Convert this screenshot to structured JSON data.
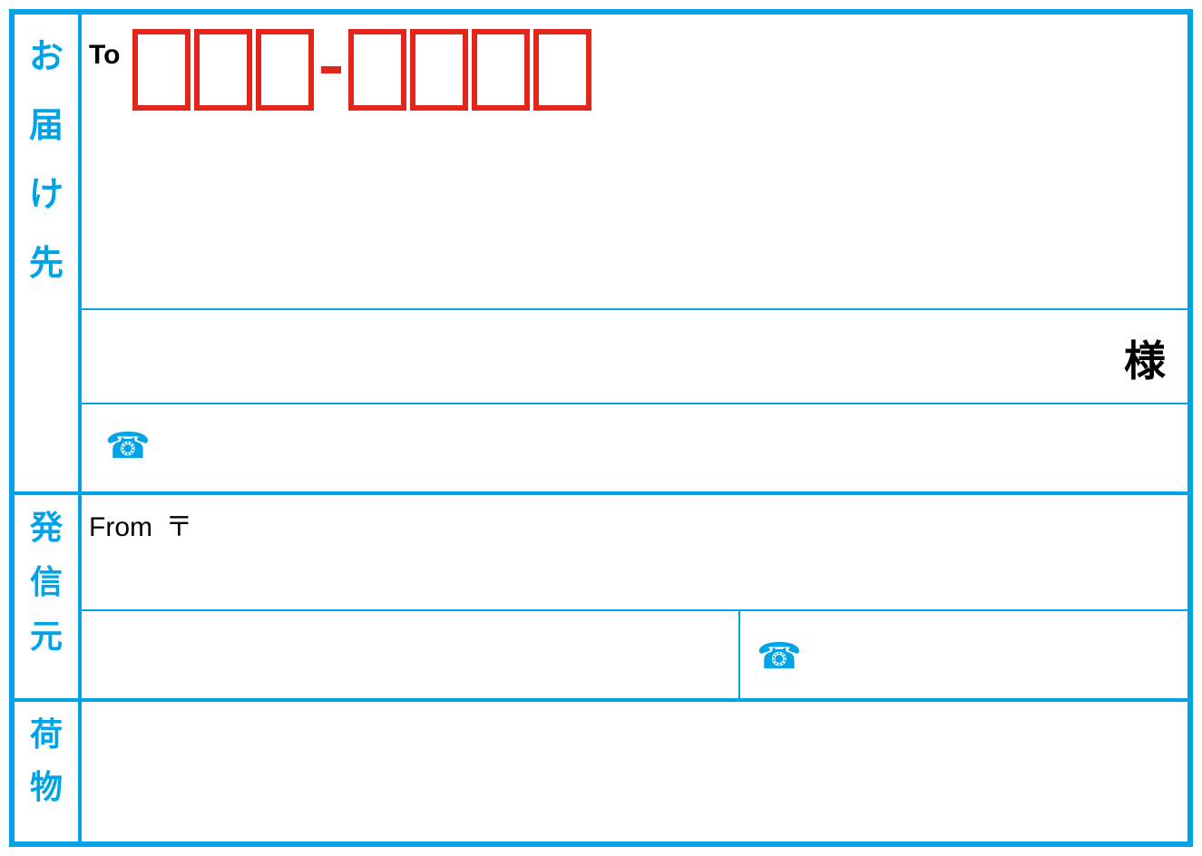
{
  "labels": {
    "recipient_section": "お届け先",
    "sender_section": "発信元",
    "cargo_section": "荷物",
    "to": "To",
    "from": "From",
    "postal_mark": "〒",
    "honorific": "様"
  },
  "postal_code_structure": {
    "part1_digits": 3,
    "part2_digits": 4
  },
  "fields": {
    "recipient_postal_code": "",
    "recipient_address": "",
    "recipient_name": "",
    "recipient_phone": "",
    "sender_postal_code": "",
    "sender_address": "",
    "sender_name": "",
    "sender_phone": "",
    "cargo_description": ""
  },
  "colors": {
    "frame": "#00a3e6",
    "postal_box": "#e3261c",
    "text": "#000000"
  }
}
